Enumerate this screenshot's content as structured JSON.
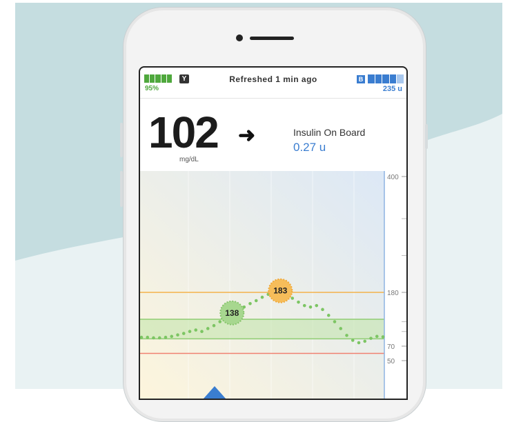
{
  "status_bar": {
    "battery_percent": "95%",
    "refreshed_text": "Refreshed 1 min ago",
    "pump_badge": "B",
    "reservoir_units": "235 u"
  },
  "glucose": {
    "value": "102",
    "unit": "mg/dL",
    "trend_arrow": "➜",
    "trend_icon": "right-arrow-icon"
  },
  "insulin_on_board": {
    "label": "Insulin On Board",
    "value": "0.27 u"
  },
  "colors": {
    "battery_green": "#4fa83d",
    "accent_blue": "#3a7dd0",
    "high_line": "#f4b24a",
    "low_line": "#f08070",
    "target_band": "#9fd08a",
    "reading_dots": "#7cc563"
  },
  "chart_data": {
    "type": "scatter",
    "y_ticks": [
      "400",
      "180",
      "70",
      "50"
    ],
    "ylim": [
      40,
      400
    ],
    "high_threshold": 180,
    "low_threshold": 60,
    "target_range": [
      85,
      125
    ],
    "annotations": [
      {
        "label": "183",
        "value": 183
      },
      {
        "label": "138",
        "value": 138
      }
    ],
    "readings": [
      88,
      88,
      87,
      87,
      88,
      90,
      93,
      96,
      100,
      103,
      100,
      106,
      112,
      120,
      130,
      138,
      145,
      150,
      157,
      163,
      170,
      176,
      181,
      183,
      178,
      168,
      160,
      153,
      150,
      153,
      145,
      133,
      120,
      106,
      92,
      82,
      77,
      80,
      86,
      90,
      89
    ]
  }
}
